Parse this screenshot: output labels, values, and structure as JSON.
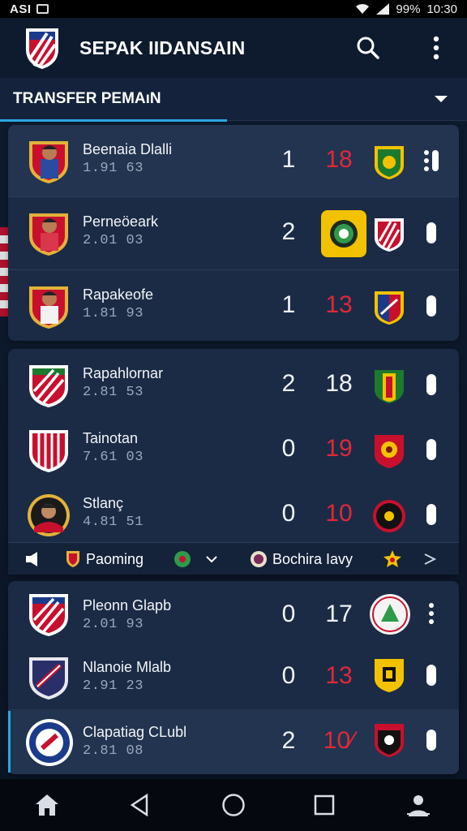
{
  "status_bar": {
    "carrier": "ASI",
    "battery": "99%",
    "time": "10:30"
  },
  "app": {
    "title": "SEPAK IIDANSAIN"
  },
  "section": {
    "title": "TRANSFER PEMAıN"
  },
  "colors": {
    "accent": "#2aa7e0",
    "red": "#e0283a",
    "white": "#f1f3f7",
    "card": "#1b2b45"
  },
  "groups": [
    {
      "rows": [
        {
          "name": "Beenaia Dlalli",
          "sub": "1.91 63",
          "score": "1",
          "num": "18",
          "num_color": "red",
          "badge": "green-lion-shield-icon"
        },
        {
          "name": "Perneöeark",
          "sub": "2.01 03",
          "score": "2",
          "num": "",
          "num_color": "white",
          "badge": "red-white-stripes-shield-icon"
        },
        {
          "name": "Rapakeofe",
          "sub": "1.81 93",
          "score": "1",
          "num": "13",
          "num_color": "red",
          "badge": "blue-red-shield-icon"
        }
      ]
    },
    {
      "rows": [
        {
          "name": "Rapahlornar",
          "sub": "2.81 53",
          "score": "2",
          "num": "18",
          "num_color": "white",
          "badge": "green-yellow-shield-icon"
        },
        {
          "name": "Tainotan",
          "sub": "7.61 03",
          "score": "0",
          "num": "19",
          "num_color": "red",
          "badge": "red-yellow-lion-shield-icon"
        },
        {
          "name": "Stlanç",
          "sub": "4.81 51",
          "score": "0",
          "num": "10",
          "num_color": "red",
          "badge": "black-round-crest-icon"
        }
      ],
      "filters": {
        "left_label": "Paoming",
        "right_label": "Bochira Iavy"
      }
    },
    {
      "rows": [
        {
          "name": "Pleonn Glapb",
          "sub": "2.01 93",
          "score": "0",
          "num": "17",
          "num_color": "white",
          "badge": "white-round-green-crest-icon"
        },
        {
          "name": "Nlanoie Mlalb",
          "sub": "2.91 23",
          "score": "0",
          "num": "13",
          "num_color": "red",
          "badge": "yellow-shield-icon"
        },
        {
          "name": "Clapatiag CLubl",
          "sub": "2.81 08",
          "score": "2",
          "num": "10⁄",
          "num_color": "red",
          "badge": "black-red-shield-icon"
        }
      ]
    }
  ],
  "nav": [
    "home-icon",
    "back-icon",
    "home-circle-icon",
    "recents-icon",
    "profile-icon"
  ]
}
